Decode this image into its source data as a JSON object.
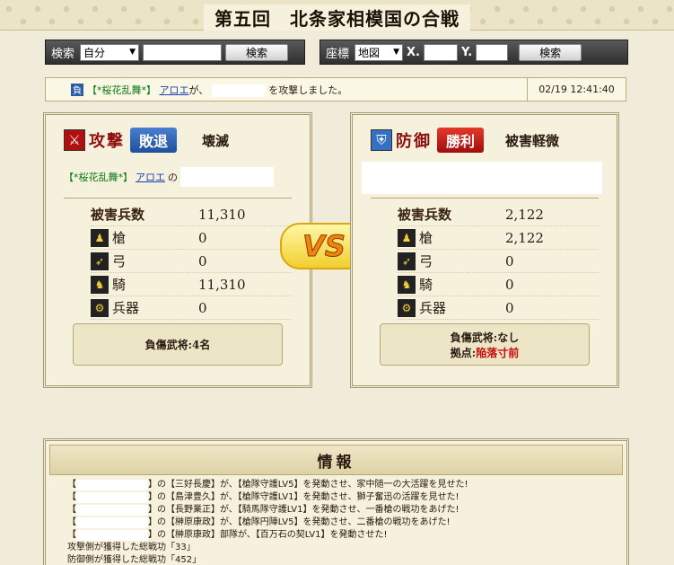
{
  "title": "第五回　北条家相模国の合戦",
  "search_bar": {
    "label": "検索",
    "select_value": "自分",
    "button": "検索"
  },
  "coord_bar": {
    "label": "座標",
    "select_value": "地図",
    "x_label": "X.",
    "y_label": "Y.",
    "button": "検索"
  },
  "log": {
    "tag": "負",
    "alliance": "【*桜花乱舞*】",
    "player": "アロエ",
    "text_ga": "が、",
    "text_end": "を攻撃しました。",
    "time": "02/19 12:41:40"
  },
  "attacker": {
    "kind": "攻撃",
    "result": "敗退",
    "status": "壊滅",
    "alliance": "【*桜花乱舞*】",
    "player": "アロエ",
    "no": "の",
    "rows": [
      {
        "name": "被害兵数",
        "value": "11,310"
      },
      {
        "name": "槍",
        "value": "0"
      },
      {
        "name": "弓",
        "value": "0"
      },
      {
        "name": "騎",
        "value": "11,310"
      },
      {
        "name": "兵器",
        "value": "0"
      }
    ],
    "casualty": "負傷武将:4名"
  },
  "defender": {
    "kind": "防御",
    "result": "勝利",
    "status": "被害軽微",
    "rows": [
      {
        "name": "被害兵数",
        "value": "2,122"
      },
      {
        "name": "槍",
        "value": "2,122"
      },
      {
        "name": "弓",
        "value": "0"
      },
      {
        "name": "騎",
        "value": "0"
      },
      {
        "name": "兵器",
        "value": "0"
      }
    ],
    "casualty": "負傷武将:なし",
    "base_label": "拠点:",
    "base_value": "陥落寸前"
  },
  "vs": "VS",
  "info": {
    "heading": "情報",
    "lines": [
      "】の【三好長慶】が、【槍隊守護LV5】を発動させ、家中随一の大活躍を見せた!",
      "】の【島津豊久】が、【槍隊守護LV1】を発動させ、獅子奮迅の活躍を見せた!",
      "】の【長野業正】が、【騎馬隊守護LV1】を発動させ、一番槍の戦功をあげた!",
      "】の【榊原康政】が、【槍隊円陣LV5】を発動させ、二番槍の戦功をあげた!",
      "】の【榊原康政】部隊が、【百万石の契LV1】を発動させた!"
    ],
    "bracket": "【",
    "attack_merit": "攻撃側が獲得した総戦功「33」",
    "defense_merit": "防御側が獲得した総戦功「452」"
  }
}
